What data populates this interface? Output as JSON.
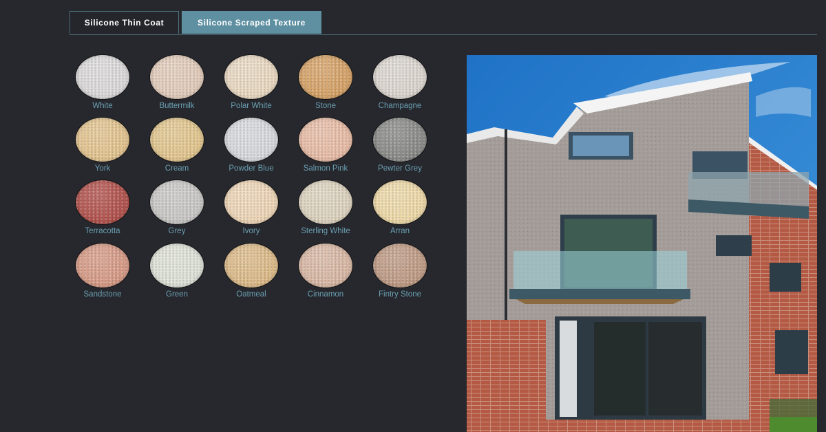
{
  "tabs": [
    {
      "label": "Silicone Thin Coat",
      "active": false
    },
    {
      "label": "Silicone Scraped Texture",
      "active": true
    }
  ],
  "accent_color": "#5e90a1",
  "label_color": "#6a9fb2",
  "swatches": [
    {
      "name": "White",
      "color": "#dcdadb"
    },
    {
      "name": "Buttermilk",
      "color": "#e2ccbb"
    },
    {
      "name": "Polar White",
      "color": "#ead9c2"
    },
    {
      "name": "Stone",
      "color": "#d6a267"
    },
    {
      "name": "Champagne",
      "color": "#dcd6d0"
    },
    {
      "name": "York",
      "color": "#e3c48f"
    },
    {
      "name": "Cream",
      "color": "#e2c68e"
    },
    {
      "name": "Powder Blue",
      "color": "#d7d9de"
    },
    {
      "name": "Salmon Pink",
      "color": "#e8bca6"
    },
    {
      "name": "Pewter Grey",
      "color": "#8a8a88"
    },
    {
      "name": "Terracotta",
      "color": "#b2524d"
    },
    {
      "name": "Grey",
      "color": "#c9c8c6"
    },
    {
      "name": "Ivory",
      "color": "#eed6b7"
    },
    {
      "name": "Sterling White",
      "color": "#ddd3bf"
    },
    {
      "name": "Arran",
      "color": "#eed9a8"
    },
    {
      "name": "Sandstone",
      "color": "#d79b86"
    },
    {
      "name": "Green",
      "color": "#dfe2d8"
    },
    {
      "name": "Oatmeal",
      "color": "#ddbb89"
    },
    {
      "name": "Cinnamon",
      "color": "#d9b8a5"
    },
    {
      "name": "Fintry Stone",
      "color": "#bf9b85"
    }
  ],
  "preview_image": {
    "description": "house-exterior-photo",
    "render_color": "#a39c98"
  }
}
